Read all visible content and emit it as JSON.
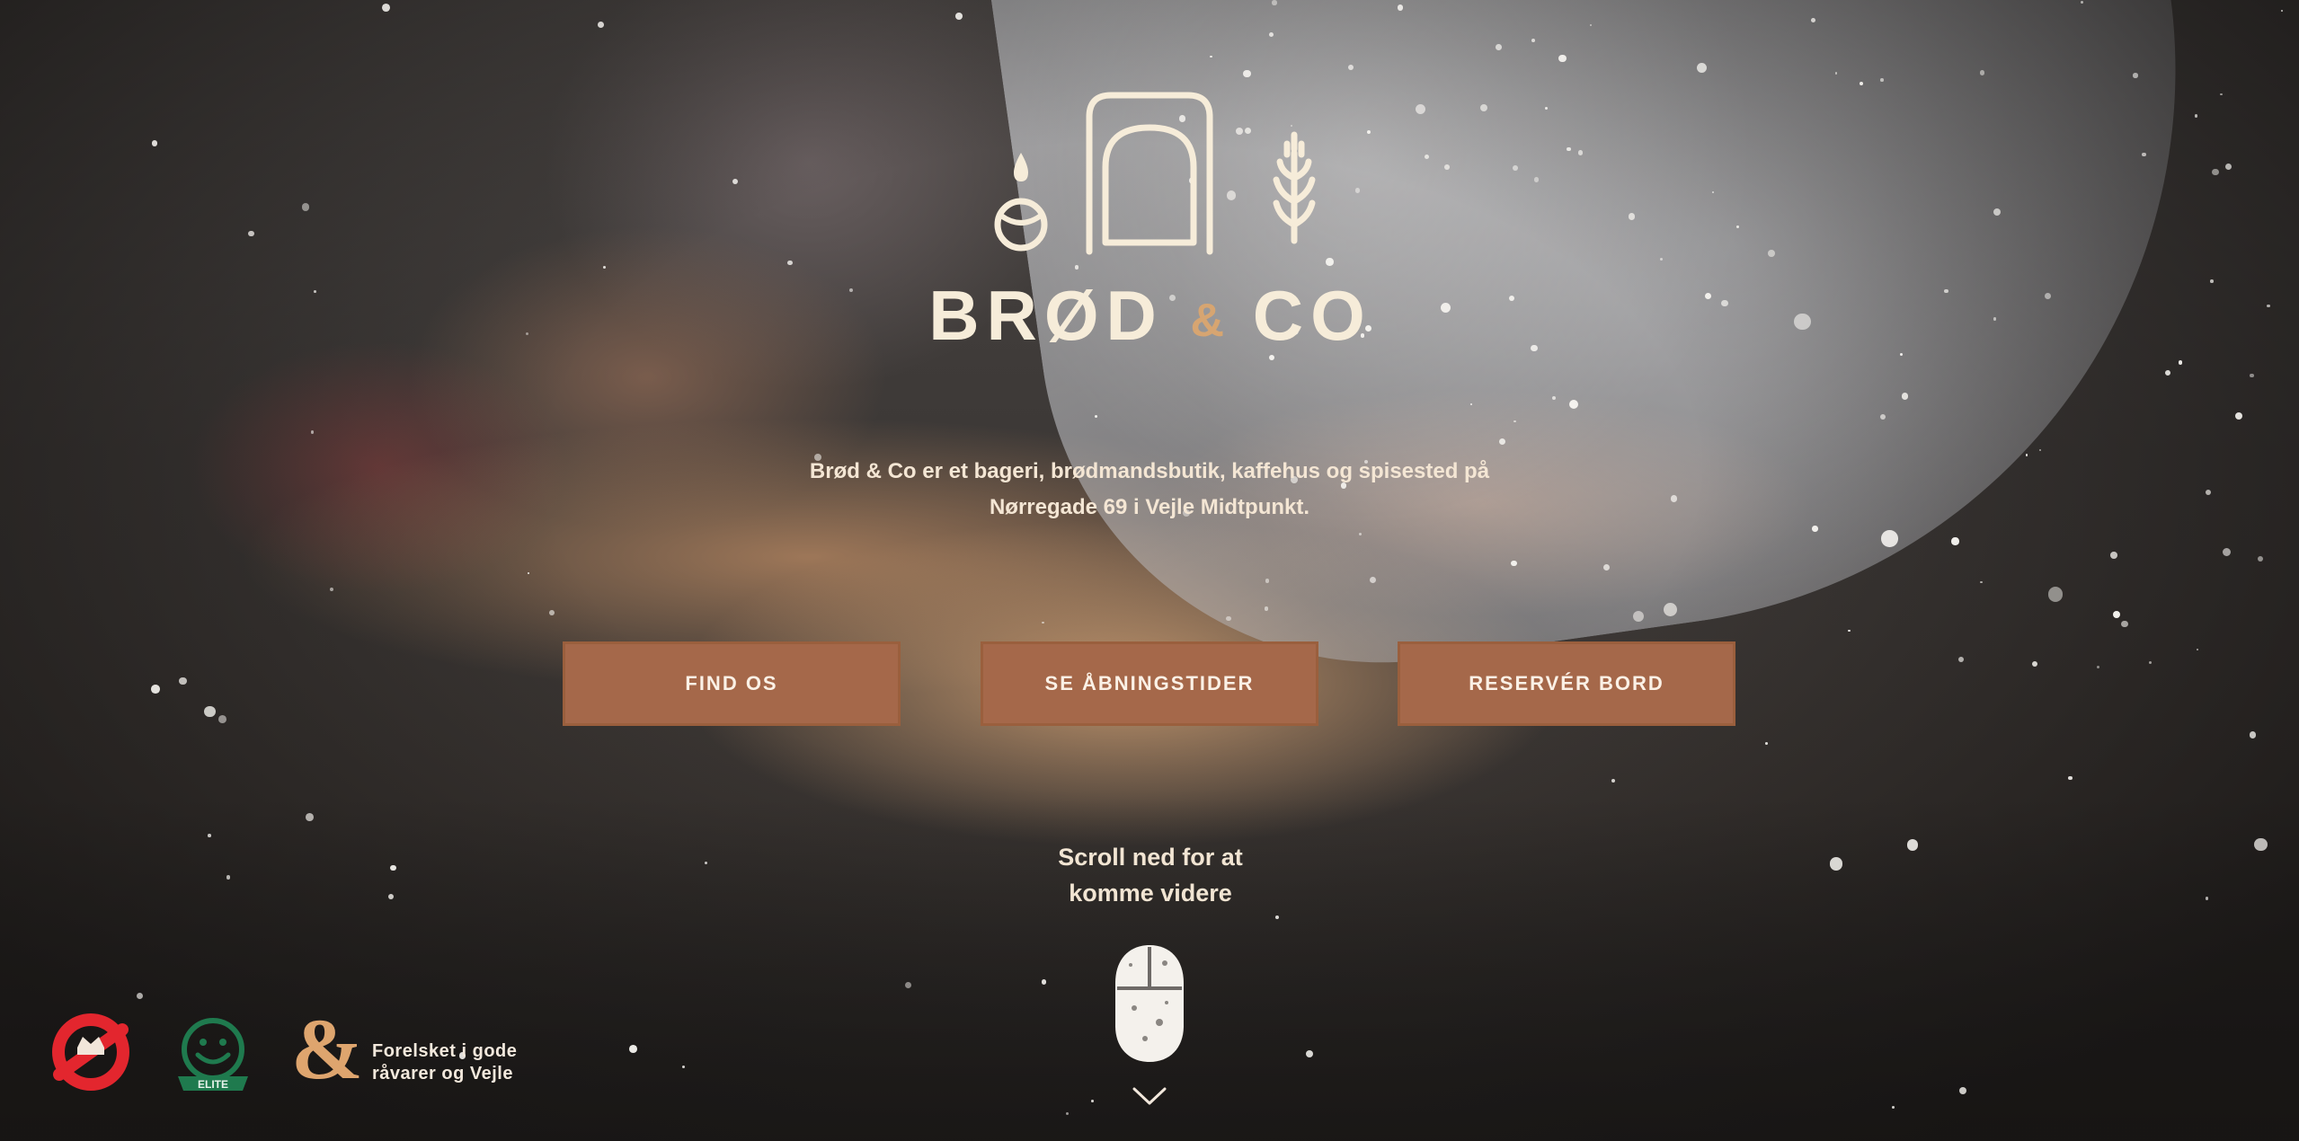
{
  "brand": {
    "name_left": "BRØD",
    "name_amp": "&",
    "name_right": "CO"
  },
  "hero": {
    "tagline_line1": "Brød & Co er et bageri, brødmandsbutik, kaffehus og spisested på",
    "tagline_line2": "Nørregade 69 i Vejle Midtpunkt."
  },
  "buttons": {
    "find": "FIND OS",
    "hours": "SE ÅBNINGSTIDER",
    "reserve": "RESERVÉR BORD"
  },
  "scroll": {
    "line1": "Scroll ned for at",
    "line2": "komme videre"
  },
  "footer": {
    "badge_label": "ELITE",
    "slogan_line1": "Forelsket i gode",
    "slogan_line2": "råvarer og Vejle"
  },
  "icons": {
    "logo": "bakery-oven-logo-icon",
    "scroll": "mouse-icon",
    "chevron": "chevron-down-icon",
    "crown": "food-authority-crown-icon",
    "smiley": "elite-smiley-icon",
    "amp": "ampersand-logo-icon"
  },
  "colors": {
    "button_bg": "#a5684a",
    "cream": "#f6ecd9",
    "accent_amp": "#d7a571",
    "crown_red": "#e3262e",
    "smiley_green": "#1f7a4e"
  }
}
